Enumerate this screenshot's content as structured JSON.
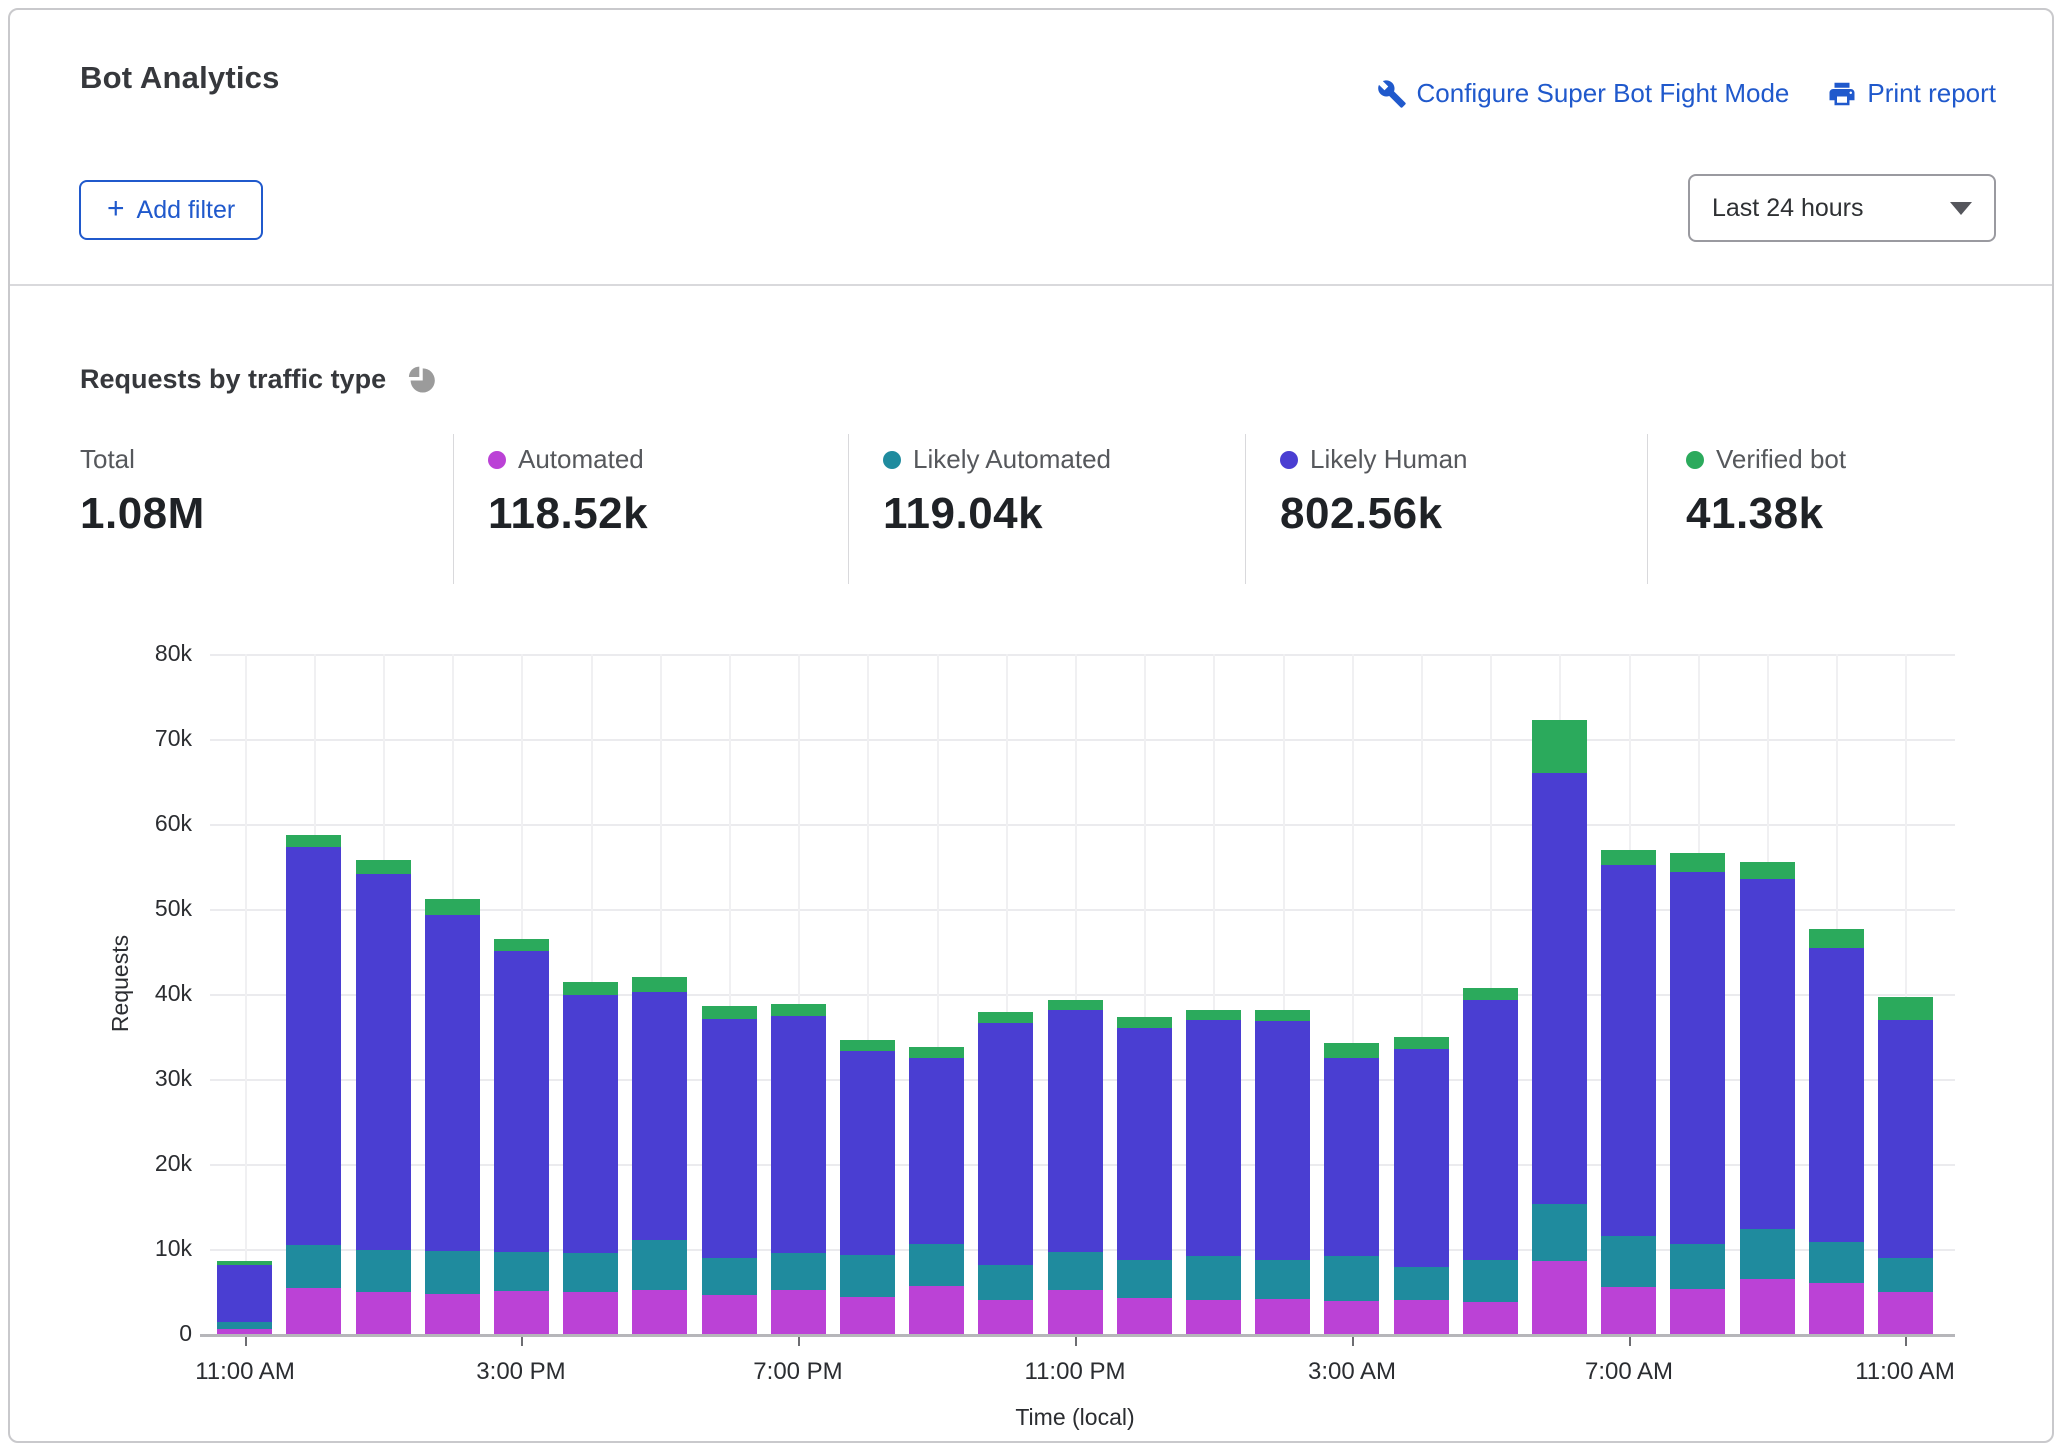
{
  "header": {
    "title": "Bot Analytics",
    "configure_link": "Configure Super Bot Fight Mode",
    "print_link": "Print report"
  },
  "filters": {
    "add_filter_label": "Add filter"
  },
  "time_range": {
    "selected": "Last 24 hours"
  },
  "section": {
    "title": "Requests by traffic type"
  },
  "link_color": "#2059cc",
  "stats": [
    {
      "label": "Total",
      "value": "1.08M",
      "color": null
    },
    {
      "label": "Automated",
      "value": "118.52k",
      "color": "#bb42d6"
    },
    {
      "label": "Likely Automated",
      "value": "119.04k",
      "color": "#1f8b9e"
    },
    {
      "label": "Likely Human",
      "value": "802.56k",
      "color": "#4a3ed2"
    },
    {
      "label": "Verified bot",
      "value": "41.38k",
      "color": "#2baa5c"
    }
  ],
  "chart_data": {
    "type": "bar",
    "stacked": true,
    "title": "Requests by traffic type",
    "xlabel": "Time (local)",
    "ylabel": "Requests",
    "unit": "thousands of requests",
    "ylim": [
      0,
      80
    ],
    "y_ticks": [
      "0",
      "10k",
      "20k",
      "30k",
      "40k",
      "50k",
      "60k",
      "70k",
      "80k"
    ],
    "grid": true,
    "x": [
      "11:00 AM",
      "12:00 PM",
      "1:00 PM",
      "2:00 PM",
      "3:00 PM",
      "4:00 PM",
      "5:00 PM",
      "6:00 PM",
      "7:00 PM",
      "8:00 PM",
      "9:00 PM",
      "10:00 PM",
      "11:00 PM",
      "12:00 AM",
      "1:00 AM",
      "2:00 AM",
      "3:00 AM",
      "4:00 AM",
      "5:00 AM",
      "6:00 AM",
      "7:00 AM",
      "8:00 AM",
      "9:00 AM",
      "10:00 AM",
      "11:00 AM"
    ],
    "x_tick_indices": [
      0,
      4,
      8,
      12,
      16,
      20,
      24
    ],
    "x_tick_labels": [
      "11:00 AM",
      "3:00 PM",
      "7:00 PM",
      "11:00 PM",
      "3:00 AM",
      "7:00 AM",
      "11:00 AM"
    ],
    "series": [
      {
        "key": "automated",
        "name": "Automated",
        "color": "#bb42d6",
        "values": [
          0.6,
          5.4,
          4.9,
          4.7,
          5.1,
          4.9,
          5.2,
          4.6,
          5.2,
          4.4,
          5.6,
          4.0,
          5.2,
          4.2,
          4.0,
          4.1,
          3.9,
          3.9,
          3.8,
          8.5,
          5.5,
          5.3,
          6.4,
          5.9,
          4.9
        ]
      },
      {
        "key": "likely_automated",
        "name": "Likely Automated",
        "color": "#1f8b9e",
        "values": [
          0.8,
          5.1,
          5.0,
          5.1,
          4.5,
          4.6,
          5.9,
          4.3,
          4.3,
          4.9,
          5.0,
          4.1,
          4.4,
          4.5,
          5.2,
          4.6,
          5.2,
          3.9,
          4.9,
          6.7,
          6.0,
          5.3,
          5.9,
          4.9,
          4.0
        ]
      },
      {
        "key": "likely_human",
        "name": "Likely Human",
        "color": "#4a3ed2",
        "values": [
          6.7,
          46.8,
          44.2,
          39.5,
          35.5,
          30.4,
          29.1,
          28.2,
          27.9,
          24.0,
          21.9,
          28.5,
          28.5,
          27.3,
          27.7,
          28.1,
          23.3,
          25.7,
          30.6,
          50.8,
          43.6,
          43.8,
          41.2,
          34.6,
          28.0
        ]
      },
      {
        "key": "verified_bot",
        "name": "Verified bot",
        "color": "#2baa5c",
        "values": [
          0.5,
          1.4,
          1.7,
          1.9,
          1.4,
          1.5,
          1.8,
          1.5,
          1.4,
          1.3,
          1.3,
          1.3,
          1.2,
          1.3,
          1.2,
          1.3,
          1.8,
          1.4,
          1.4,
          6.2,
          1.8,
          2.2,
          2.0,
          2.2,
          2.7
        ]
      }
    ]
  }
}
